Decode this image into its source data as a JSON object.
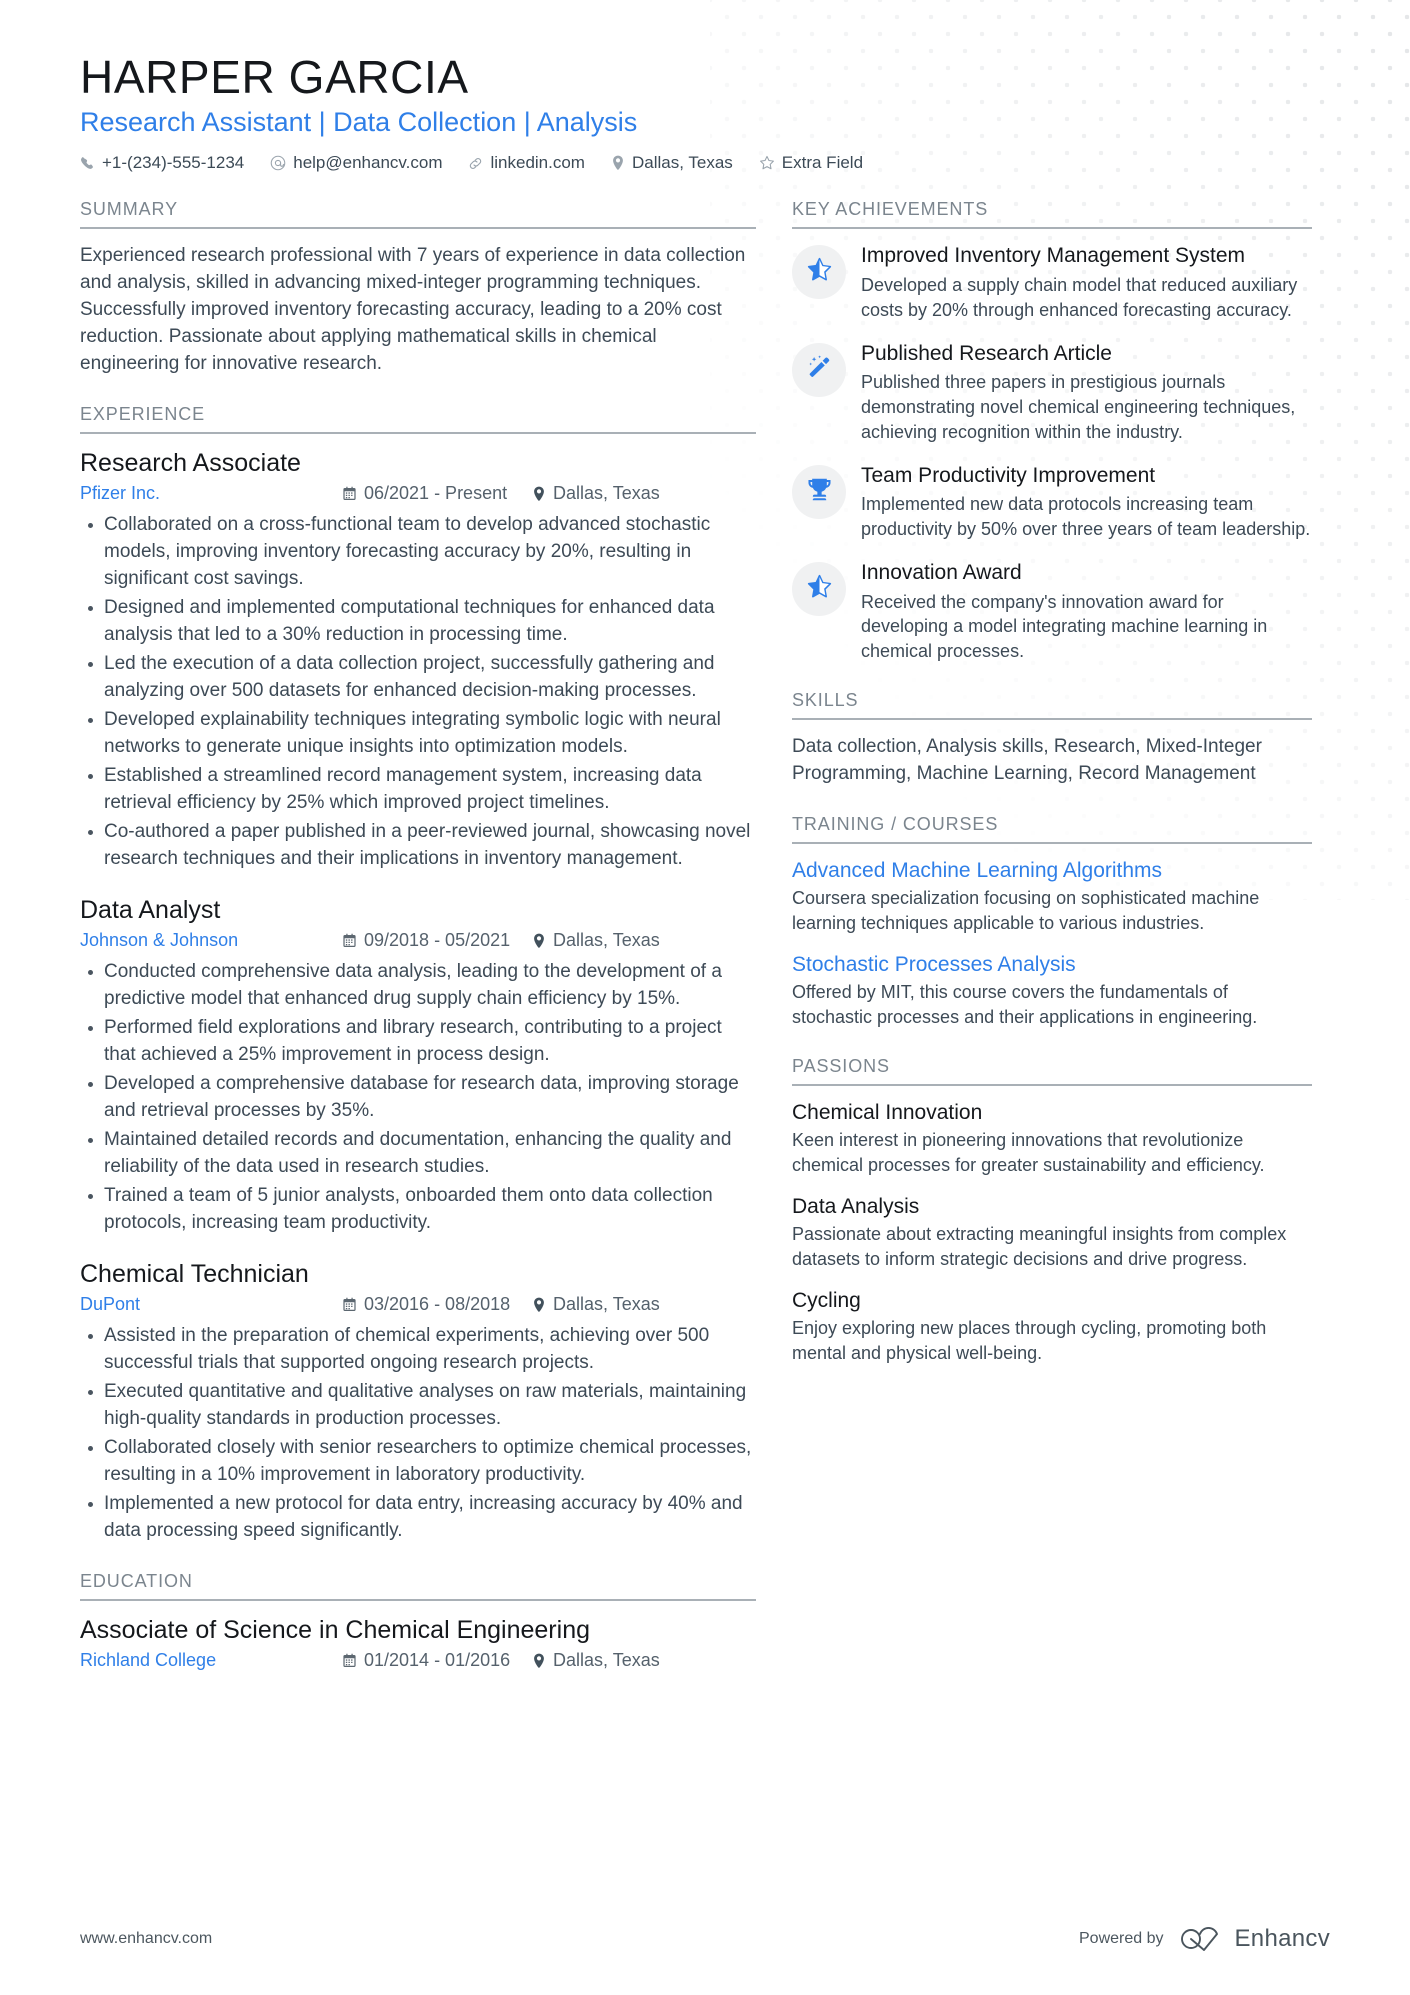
{
  "theme": {
    "accent": "#2f7fe8",
    "heading": "#15181c",
    "body_text": "#3d4a56",
    "section_label": "#7b858e",
    "rule": "#a9b0b6",
    "badge_bg": "#f0f1f2",
    "dot_pattern": "#e4e6e8"
  },
  "header": {
    "name": "HARPER GARCIA",
    "headline": "Research Assistant | Data Collection | Analysis",
    "contacts": [
      {
        "icon": "phone-icon",
        "text": "+1-(234)-555-1234"
      },
      {
        "icon": "email-icon",
        "text": "help@enhancv.com"
      },
      {
        "icon": "link-icon",
        "text": "linkedin.com"
      },
      {
        "icon": "location-pin-icon",
        "text": "Dallas, Texas"
      },
      {
        "icon": "star-outline-icon",
        "text": "Extra Field"
      }
    ]
  },
  "left": {
    "summary": {
      "label": "SUMMARY",
      "text": "Experienced research professional with 7 years of experience in data collection and analysis, skilled in advancing mixed-integer programming techniques. Successfully improved inventory forecasting accuracy, leading to a 20% cost reduction. Passionate about applying mathematical skills in chemical engineering for innovative research."
    },
    "experience": {
      "label": "EXPERIENCE",
      "entries": [
        {
          "title": "Research Associate",
          "org": "Pfizer Inc.",
          "date": "06/2021 - Present",
          "location": "Dallas, Texas",
          "bullets": [
            "Collaborated on a cross-functional team to develop advanced stochastic models, improving inventory forecasting accuracy by 20%, resulting in significant cost savings.",
            "Designed and implemented computational techniques for enhanced data analysis that led to a 30% reduction in processing time.",
            "Led the execution of a data collection project, successfully gathering and analyzing over 500 datasets for enhanced decision-making processes.",
            "Developed explainability techniques integrating symbolic logic with neural networks to generate unique insights into optimization models.",
            "Established a streamlined record management system, increasing data retrieval efficiency by 25% which improved project timelines.",
            "Co-authored a paper published in a peer-reviewed journal, showcasing novel research techniques and their implications in inventory management."
          ]
        },
        {
          "title": "Data Analyst",
          "org": "Johnson & Johnson",
          "date": "09/2018 - 05/2021",
          "location": "Dallas, Texas",
          "bullets": [
            "Conducted comprehensive data analysis, leading to the development of a predictive model that enhanced drug supply chain efficiency by 15%.",
            "Performed field explorations and library research, contributing to a project that achieved a 25% improvement in process design.",
            "Developed a comprehensive database for research data, improving storage and retrieval processes by 35%.",
            "Maintained detailed records and documentation, enhancing the quality and reliability of the data used in research studies.",
            "Trained a team of 5 junior analysts, onboarded them onto data collection protocols, increasing team productivity."
          ]
        },
        {
          "title": "Chemical Technician",
          "org": "DuPont",
          "date": "03/2016 - 08/2018",
          "location": "Dallas, Texas",
          "bullets": [
            "Assisted in the preparation of chemical experiments, achieving over 500 successful trials that supported ongoing research projects.",
            "Executed quantitative and qualitative analyses on raw materials, maintaining high-quality standards in production processes.",
            "Collaborated closely with senior researchers to optimize chemical processes, resulting in a 10% improvement in laboratory productivity.",
            "Implemented a new protocol for data entry, increasing accuracy by 40% and data processing speed significantly."
          ]
        }
      ]
    },
    "education": {
      "label": "EDUCATION",
      "entries": [
        {
          "title": "Associate of Science in Chemical Engineering",
          "org": "Richland College",
          "date": "01/2014 - 01/2016",
          "location": "Dallas, Texas"
        }
      ]
    }
  },
  "right": {
    "achievements": {
      "label": "KEY ACHIEVEMENTS",
      "items": [
        {
          "icon": "star-icon",
          "title": "Improved Inventory Management System",
          "desc": "Developed a supply chain model that reduced auxiliary costs by 20% through enhanced forecasting accuracy."
        },
        {
          "icon": "magic-wand-icon",
          "title": "Published Research Article",
          "desc": "Published three papers in prestigious journals demonstrating novel chemical engineering techniques, achieving recognition within the industry."
        },
        {
          "icon": "trophy-icon",
          "title": "Team Productivity Improvement",
          "desc": "Implemented new data protocols increasing team productivity by 50% over three years of team leadership."
        },
        {
          "icon": "star-icon",
          "title": "Innovation Award",
          "desc": "Received the company's innovation award for developing a model integrating machine learning in chemical processes."
        }
      ]
    },
    "skills": {
      "label": "SKILLS",
      "text": "Data collection, Analysis skills, Research, Mixed-Integer Programming, Machine Learning, Record Management"
    },
    "training": {
      "label": "TRAINING / COURSES",
      "items": [
        {
          "title": "Advanced Machine Learning Algorithms",
          "desc": "Coursera specialization focusing on sophisticated machine learning techniques applicable to various industries."
        },
        {
          "title": "Stochastic Processes Analysis",
          "desc": "Offered by MIT, this course covers the fundamentals of stochastic processes and their applications in engineering."
        }
      ]
    },
    "passions": {
      "label": "PASSIONS",
      "items": [
        {
          "title": "Chemical Innovation",
          "desc": "Keen interest in pioneering innovations that revolutionize chemical processes for greater sustainability and efficiency."
        },
        {
          "title": "Data Analysis",
          "desc": "Passionate about extracting meaningful insights from complex datasets to inform strategic decisions and drive progress."
        },
        {
          "title": "Cycling",
          "desc": "Enjoy exploring new places through cycling, promoting both mental and physical well-being."
        }
      ]
    }
  },
  "footer": {
    "website": "www.enhancv.com",
    "powered_by": "Powered by",
    "brand": "Enhancv"
  }
}
